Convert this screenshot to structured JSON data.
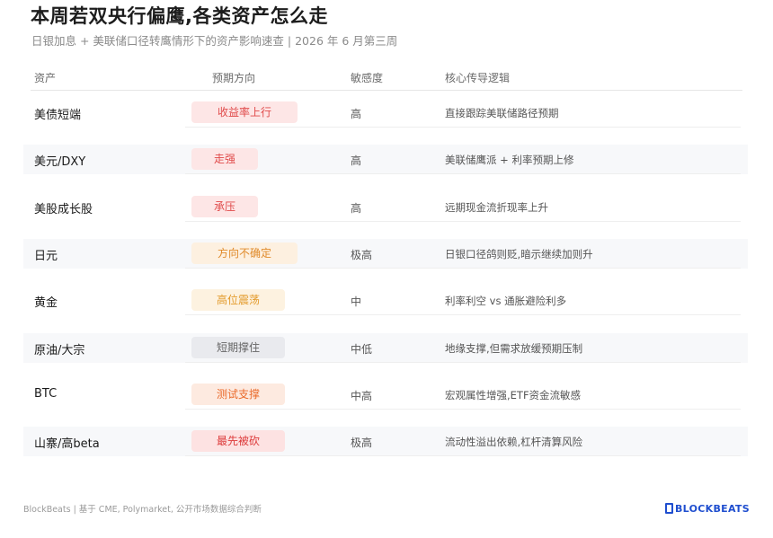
{
  "title": "本周若双央行偏鹰,各类资产怎么走",
  "subtitle": "日银加息 + 美联储口径转鹰情形下的资产影响速查 | 2026 年 6 月第三周",
  "headers": {
    "asset": "资产",
    "direction": "预期方向",
    "sensitivity": "敏感度",
    "logic": "核心传导逻辑"
  },
  "rows": [
    {
      "asset": "美债短端",
      "direction": "收益率上行",
      "sensitivity": "高",
      "logic": "直接跟踪美联储路径预期",
      "pill_bg": "#fde6e6",
      "pill_fg": "#e04a4a"
    },
    {
      "asset": "美元/DXY",
      "direction": "走强",
      "sensitivity": "高",
      "logic": "美联储鹰派 + 利率预期上修",
      "pill_bg": "#fde6e6",
      "pill_fg": "#e04a4a"
    },
    {
      "asset": "美股成长股",
      "direction": "承压",
      "sensitivity": "高",
      "logic": "远期现金流折现率上升",
      "pill_bg": "#fde6e6",
      "pill_fg": "#e04a4a"
    },
    {
      "asset": "日元",
      "direction": "方向不确定",
      "sensitivity": "极高",
      "logic": "日银口径鸽则贬,暗示继续加则升",
      "pill_bg": "#fdf0e0",
      "pill_fg": "#e08a2a"
    },
    {
      "asset": "黄金",
      "direction": "高位震荡",
      "sensitivity": "中",
      "logic": "利率利空 vs 通胀避险利多",
      "pill_bg": "#fdf2e0",
      "pill_fg": "#e39a2a"
    },
    {
      "asset": "原油/大宗",
      "direction": "短期撑住",
      "sensitivity": "中低",
      "logic": "地缘支撑,但需求放缓预期压制",
      "pill_bg": "#e9eaee",
      "pill_fg": "#666666"
    },
    {
      "asset": "BTC",
      "direction": "测试支撑",
      "sensitivity": "中高",
      "logic": "宏观属性增强,ETF资金流敏感",
      "pill_bg": "#fdeae0",
      "pill_fg": "#ea6a2a"
    },
    {
      "asset": "山寨/高beta",
      "direction": "最先被砍",
      "sensitivity": "极高",
      "logic": "流动性溢出依赖,杠杆清算风险",
      "pill_bg": "#fde2e2",
      "pill_fg": "#dd3a3a"
    }
  ],
  "footer": "BlockBeats | 基于 CME, Polymarket, 公开市场数据综合判断",
  "logo": {
    "text": "BLOCKBEATS",
    "color": "#1f4ecf"
  }
}
